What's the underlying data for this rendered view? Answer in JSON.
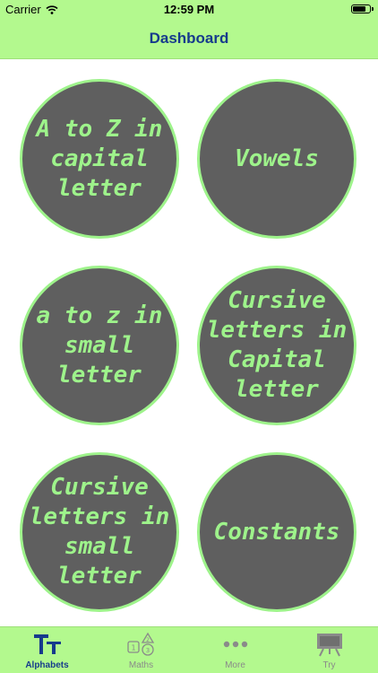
{
  "status_bar": {
    "carrier": "Carrier",
    "time": "12:59 PM"
  },
  "nav": {
    "title": "Dashboard"
  },
  "cards": [
    {
      "label": "A to Z in\ncapital\nletter"
    },
    {
      "label": "Vowels"
    },
    {
      "label": "a to z in\nsmall\nletter"
    },
    {
      "label": "Cursive\nletters in\nCapital\nletter"
    },
    {
      "label": "Cursive\nletters in\nsmall\nletter"
    },
    {
      "label": "Constants"
    }
  ],
  "tabs": [
    {
      "label": "Alphabets",
      "icon": "alphabets-icon",
      "active": true
    },
    {
      "label": "Maths",
      "icon": "maths-icon",
      "active": false
    },
    {
      "label": "More",
      "icon": "more-icon",
      "active": false
    },
    {
      "label": "Try",
      "icon": "easel-icon",
      "active": false
    }
  ],
  "colors": {
    "bar_green": "#b3f98e",
    "circle_fill": "#5f5f5f",
    "circle_text": "#9ef38b",
    "title_blue": "#163b8c"
  }
}
